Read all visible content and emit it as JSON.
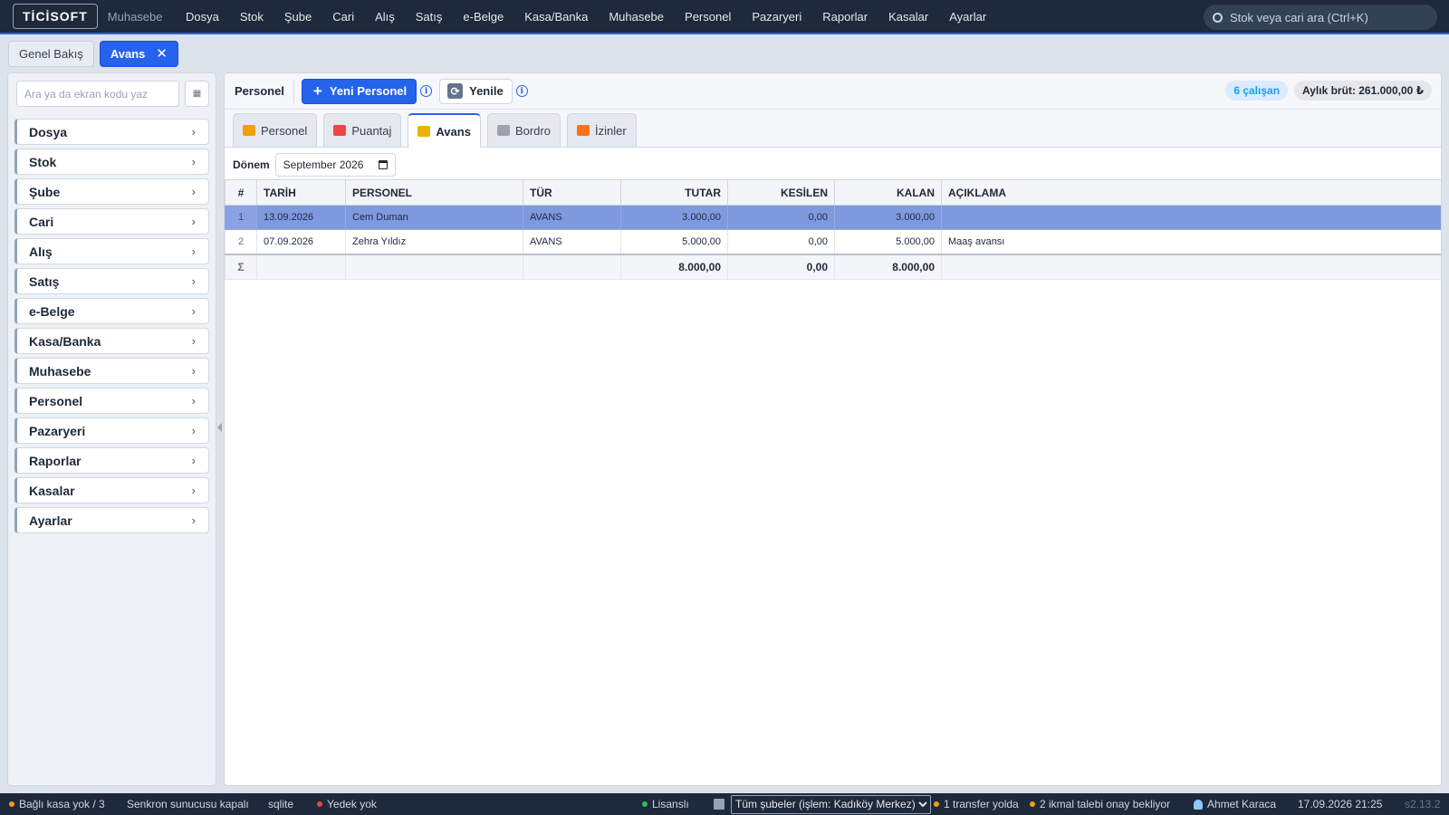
{
  "topbar": {
    "logo": "TİCİSOFT",
    "module": "Muhasebe",
    "menu": [
      "Dosya",
      "Stok",
      "Şube",
      "Cari",
      "Alış",
      "Satış",
      "e-Belge",
      "Kasa/Banka",
      "Muhasebe",
      "Personel",
      "Pazaryeri",
      "Raporlar",
      "Kasalar",
      "Ayarlar"
    ],
    "search_placeholder": "Stok veya cari ara (Ctrl+K)"
  },
  "page_tabs": {
    "overview": "Genel Bakış",
    "active": "Avans",
    "close": "✕"
  },
  "sidebar": {
    "search_placeholder": "Ara ya da ekran kodu yaz",
    "grid_button": "▦",
    "items": [
      "Dosya",
      "Stok",
      "Şube",
      "Cari",
      "Alış",
      "Satış",
      "e-Belge",
      "Kasa/Banka",
      "Muhasebe",
      "Personel",
      "Pazaryeri",
      "Raporlar",
      "Kasalar",
      "Ayarlar"
    ],
    "chevron": "›"
  },
  "toolbar": {
    "title": "Personel",
    "new_label": "Yeni Personel",
    "refresh_label": "Yenile",
    "employee_count": "6 çalışan",
    "gross": "Aylık brüt: 261.000,00 ₺"
  },
  "subtabs": [
    {
      "label": "Personel",
      "icon": "person-icon",
      "color": "#f59e0b"
    },
    {
      "label": "Puantaj",
      "icon": "calendar-icon",
      "color": "#ef4444"
    },
    {
      "label": "Avans",
      "icon": "money-icon",
      "color": "#eab308"
    },
    {
      "label": "Bordro",
      "icon": "document-icon",
      "color": "#9ca3af"
    },
    {
      "label": "İzinler",
      "icon": "beach-icon",
      "color": "#f97316"
    }
  ],
  "filter": {
    "label": "Dönem",
    "period": "September  2026"
  },
  "table": {
    "columns": [
      "#",
      "TARİH",
      "PERSONEL",
      "TÜR",
      "TUTAR",
      "KESİLEN",
      "KALAN",
      "AÇIKLAMA"
    ],
    "rows": [
      [
        "1",
        "13.09.2026",
        "Cem Duman",
        "AVANS",
        "3.000,00",
        "0,00",
        "3.000,00",
        ""
      ],
      [
        "2",
        "07.09.2026",
        "Zehra Yıldız",
        "AVANS",
        "5.000,00",
        "0,00",
        "5.000,00",
        "Maaş avansı"
      ]
    ],
    "selected_row": 0,
    "totals": [
      "Σ",
      "",
      "",
      "",
      "8.000,00",
      "0,00",
      "8.000,00",
      ""
    ]
  },
  "statusbar": {
    "kasa": "Bağlı kasa yok / 3",
    "sync": "Senkron sunucusu kapalı",
    "db": "sqlite",
    "backup": "Yedek yok",
    "license": "Lisanslı",
    "branch": "Tüm şubeler (işlem: Kadıköy Merkez)",
    "transfer": "1 transfer yolda",
    "supply": "2 ikmal talebi onay bekliyor",
    "user": "Ahmet Karaca",
    "datetime": "17.09.2026 21:25",
    "version": "s2.13.2",
    "colors": {
      "kasa": "#f59e0b",
      "backup": "#ef4444",
      "license": "#22c55e",
      "transfer": "#f59e0b",
      "supply": "#f59e0b"
    }
  }
}
